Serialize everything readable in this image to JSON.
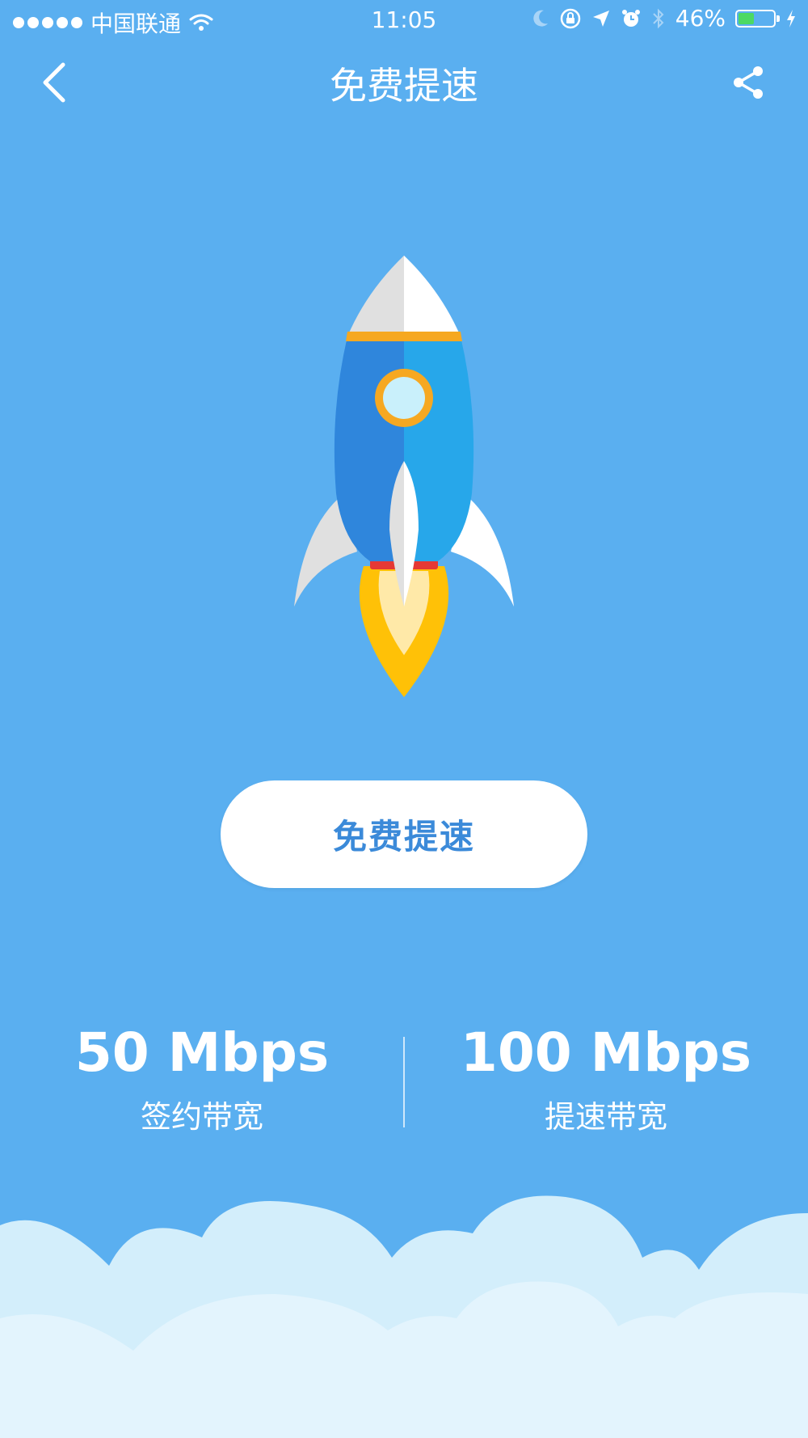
{
  "status_bar": {
    "carrier": "中国联通",
    "time": "11:05",
    "battery_percent": "46%",
    "battery_level": 0.46,
    "icons": [
      "signal-dots-icon",
      "wifi-icon",
      "moon-icon",
      "rotation-lock-icon",
      "location-arrow-icon",
      "alarm-icon",
      "bluetooth-icon",
      "battery-icon",
      "charging-bolt-icon"
    ]
  },
  "nav": {
    "title": "免费提速",
    "back_icon": "chevron-left-icon",
    "share_icon": "share-icon"
  },
  "main": {
    "illustration": "rocket-icon",
    "boost_button_label": "免费提速"
  },
  "stats": {
    "contract": {
      "value": "50 Mbps",
      "label": "签约带宽"
    },
    "boosted": {
      "value": "100 Mbps",
      "label": "提速带宽"
    }
  },
  "colors": {
    "background": "#5aaff0",
    "button_text": "#3b8ad9",
    "battery_fill": "#4cd964",
    "cloud_light": "#e3f4fd"
  }
}
